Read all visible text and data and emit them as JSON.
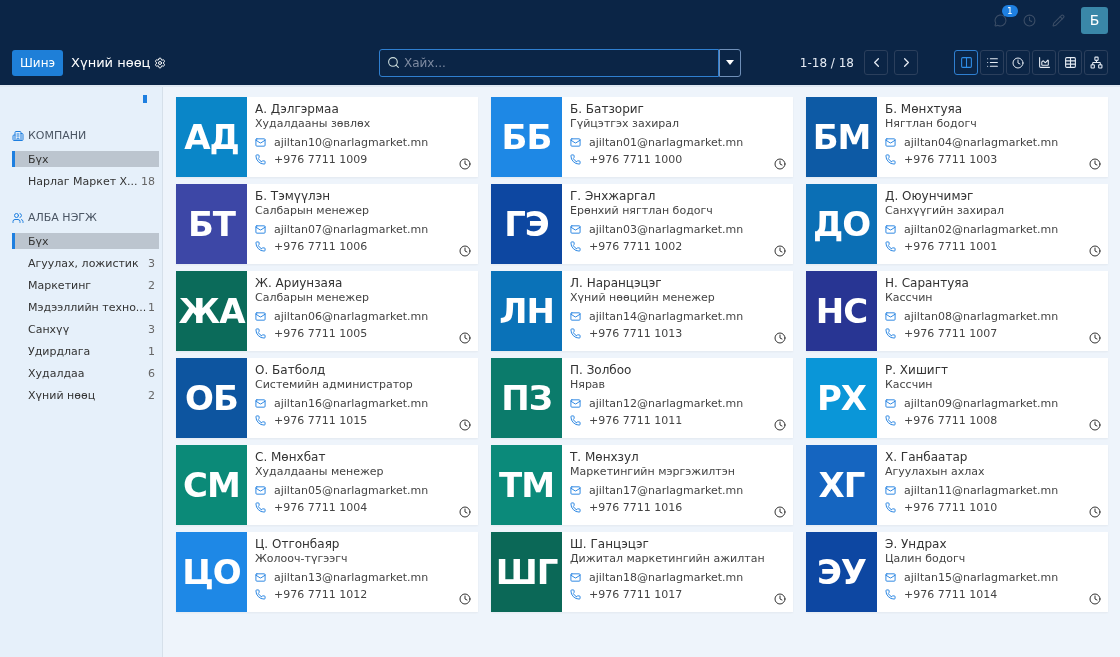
{
  "topbar": {
    "notifications": "1",
    "avatar": "Б"
  },
  "controlbar": {
    "new_button": "Шинэ",
    "title": "Хүний нөөц",
    "search": {
      "placeholder": "Хайх..."
    },
    "pager": "1-18 / 18",
    "views": [
      {
        "kind": "kanban",
        "selected": true
      },
      {
        "kind": "list",
        "selected": false
      },
      {
        "kind": "activity",
        "selected": false
      },
      {
        "kind": "graph",
        "selected": false
      },
      {
        "kind": "pivot",
        "selected": false
      },
      {
        "kind": "hierarchy",
        "selected": false
      }
    ]
  },
  "sidebar": {
    "sections": [
      {
        "kind": "company",
        "title": "КОМПАНИ",
        "items": [
          {
            "label": "Бүх",
            "selected": true
          },
          {
            "label": "Нарлаг Маркет Х...",
            "count": "18",
            "selected": false
          }
        ]
      },
      {
        "kind": "department",
        "title": "АЛБА НЭГЖ",
        "items": [
          {
            "label": "Бүх",
            "selected": true
          },
          {
            "label": "Агуулах, ложистик",
            "count": "3",
            "selected": false
          },
          {
            "label": "Маркетинг",
            "count": "2",
            "selected": false
          },
          {
            "label": "Мэдээллийн техно...",
            "count": "1",
            "selected": false
          },
          {
            "label": "Санхүү",
            "count": "3",
            "selected": false
          },
          {
            "label": "Удирдлага",
            "count": "1",
            "selected": false
          },
          {
            "label": "Худалдаа",
            "count": "6",
            "selected": false
          },
          {
            "label": "Хүний нөөц",
            "count": "2",
            "selected": false
          }
        ]
      }
    ]
  },
  "cards": [
    {
      "initials": "АД",
      "color": "#0a86c8",
      "name": "А. Дэлгэрмаа",
      "job": "Худалдааны зөвлөх",
      "email": "ajiltan10@narlagmarket.mn",
      "phone": "+976 7711 1009"
    },
    {
      "initials": "ББ",
      "color": "#1e88e5",
      "name": "Б. Батзориг",
      "job": "Гүйцэтгэх захирал",
      "email": "ajiltan01@narlagmarket.mn",
      "phone": "+976 7711 1000"
    },
    {
      "initials": "БМ",
      "color": "#0d5aa5",
      "name": "Б. Мөнхтуяа",
      "job": "Нягтлан бодогч",
      "email": "ajiltan04@narlagmarket.mn",
      "phone": "+976 7711 1003"
    },
    {
      "initials": "БТ",
      "color": "#3d47a6",
      "name": "Б. Тэмүүлэн",
      "job": "Салбарын менежер",
      "email": "ajiltan07@narlagmarket.mn",
      "phone": "+976 7711 1006"
    },
    {
      "initials": "ГЭ",
      "color": "#0d47a1",
      "name": "Г. Энхжаргал",
      "job": "Ерөнхий нягтлан бодогч",
      "email": "ajiltan03@narlagmarket.mn",
      "phone": "+976 7711 1002"
    },
    {
      "initials": "ДО",
      "color": "#0b6fb5",
      "name": "Д. Оюунчимэг",
      "job": "Санхүүгийн захирал",
      "email": "ajiltan02@narlagmarket.mn",
      "phone": "+976 7711 1001"
    },
    {
      "initials": "ЖА",
      "color": "#0b6b5a",
      "name": "Ж. Ариунзаяа",
      "job": "Салбарын менежер",
      "email": "ajiltan06@narlagmarket.mn",
      "phone": "+976 7711 1005"
    },
    {
      "initials": "ЛН",
      "color": "#0a72b8",
      "name": "Л. Наранцэцэг",
      "job": "Хүний нөөцийн менежер",
      "email": "ajiltan14@narlagmarket.mn",
      "phone": "+976 7711 1013"
    },
    {
      "initials": "НС",
      "color": "#283593",
      "name": "Н. Сарантуяа",
      "job": "Кассчин",
      "email": "ajiltan08@narlagmarket.mn",
      "phone": "+976 7711 1007"
    },
    {
      "initials": "ОБ",
      "color": "#0d55a0",
      "name": "О. Батболд",
      "job": "Системийн администратор",
      "email": "ajiltan16@narlagmarket.mn",
      "phone": "+976 7711 1015"
    },
    {
      "initials": "ПЗ",
      "color": "#0b7b6b",
      "name": "П. Золбоо",
      "job": "Нярав",
      "email": "ajiltan12@narlagmarket.mn",
      "phone": "+976 7711 1011"
    },
    {
      "initials": "РХ",
      "color": "#0a96d8",
      "name": "Р. Хишигт",
      "job": "Кассчин",
      "email": "ajiltan09@narlagmarket.mn",
      "phone": "+976 7711 1008"
    },
    {
      "initials": "СМ",
      "color": "#0b8a78",
      "name": "С. Мөнхбат",
      "job": "Худалдааны менежер",
      "email": "ajiltan05@narlagmarket.mn",
      "phone": "+976 7711 1004"
    },
    {
      "initials": "ТМ",
      "color": "#0b8a7a",
      "name": "Т. Мөнхзул",
      "job": "Маркетингийн мэргэжилтэн",
      "email": "ajiltan17@narlagmarket.mn",
      "phone": "+976 7711 1016"
    },
    {
      "initials": "ХГ",
      "color": "#1565c0",
      "name": "Х. Ганбаатар",
      "job": "Агуулахын ахлах",
      "email": "ajiltan11@narlagmarket.mn",
      "phone": "+976 7711 1010"
    },
    {
      "initials": "ЦО",
      "color": "#1e88e6",
      "name": "Ц. Отгонбаяр",
      "job": "Жолооч-түгээгч",
      "email": "ajiltan13@narlagmarket.mn",
      "phone": "+976 7711 1012"
    },
    {
      "initials": "ШГ",
      "color": "#0b6857",
      "name": "Ш. Ганцэцэг",
      "job": "Дижитал маркетингийн ажилтан",
      "email": "ajiltan18@narlagmarket.mn",
      "phone": "+976 7711 1017"
    },
    {
      "initials": "ЭУ",
      "color": "#0d47a2",
      "name": "Э. Ундрах",
      "job": "Цалин бодогч",
      "email": "ajiltan15@narlagmarket.mn",
      "phone": "+976 7711 1014"
    }
  ]
}
